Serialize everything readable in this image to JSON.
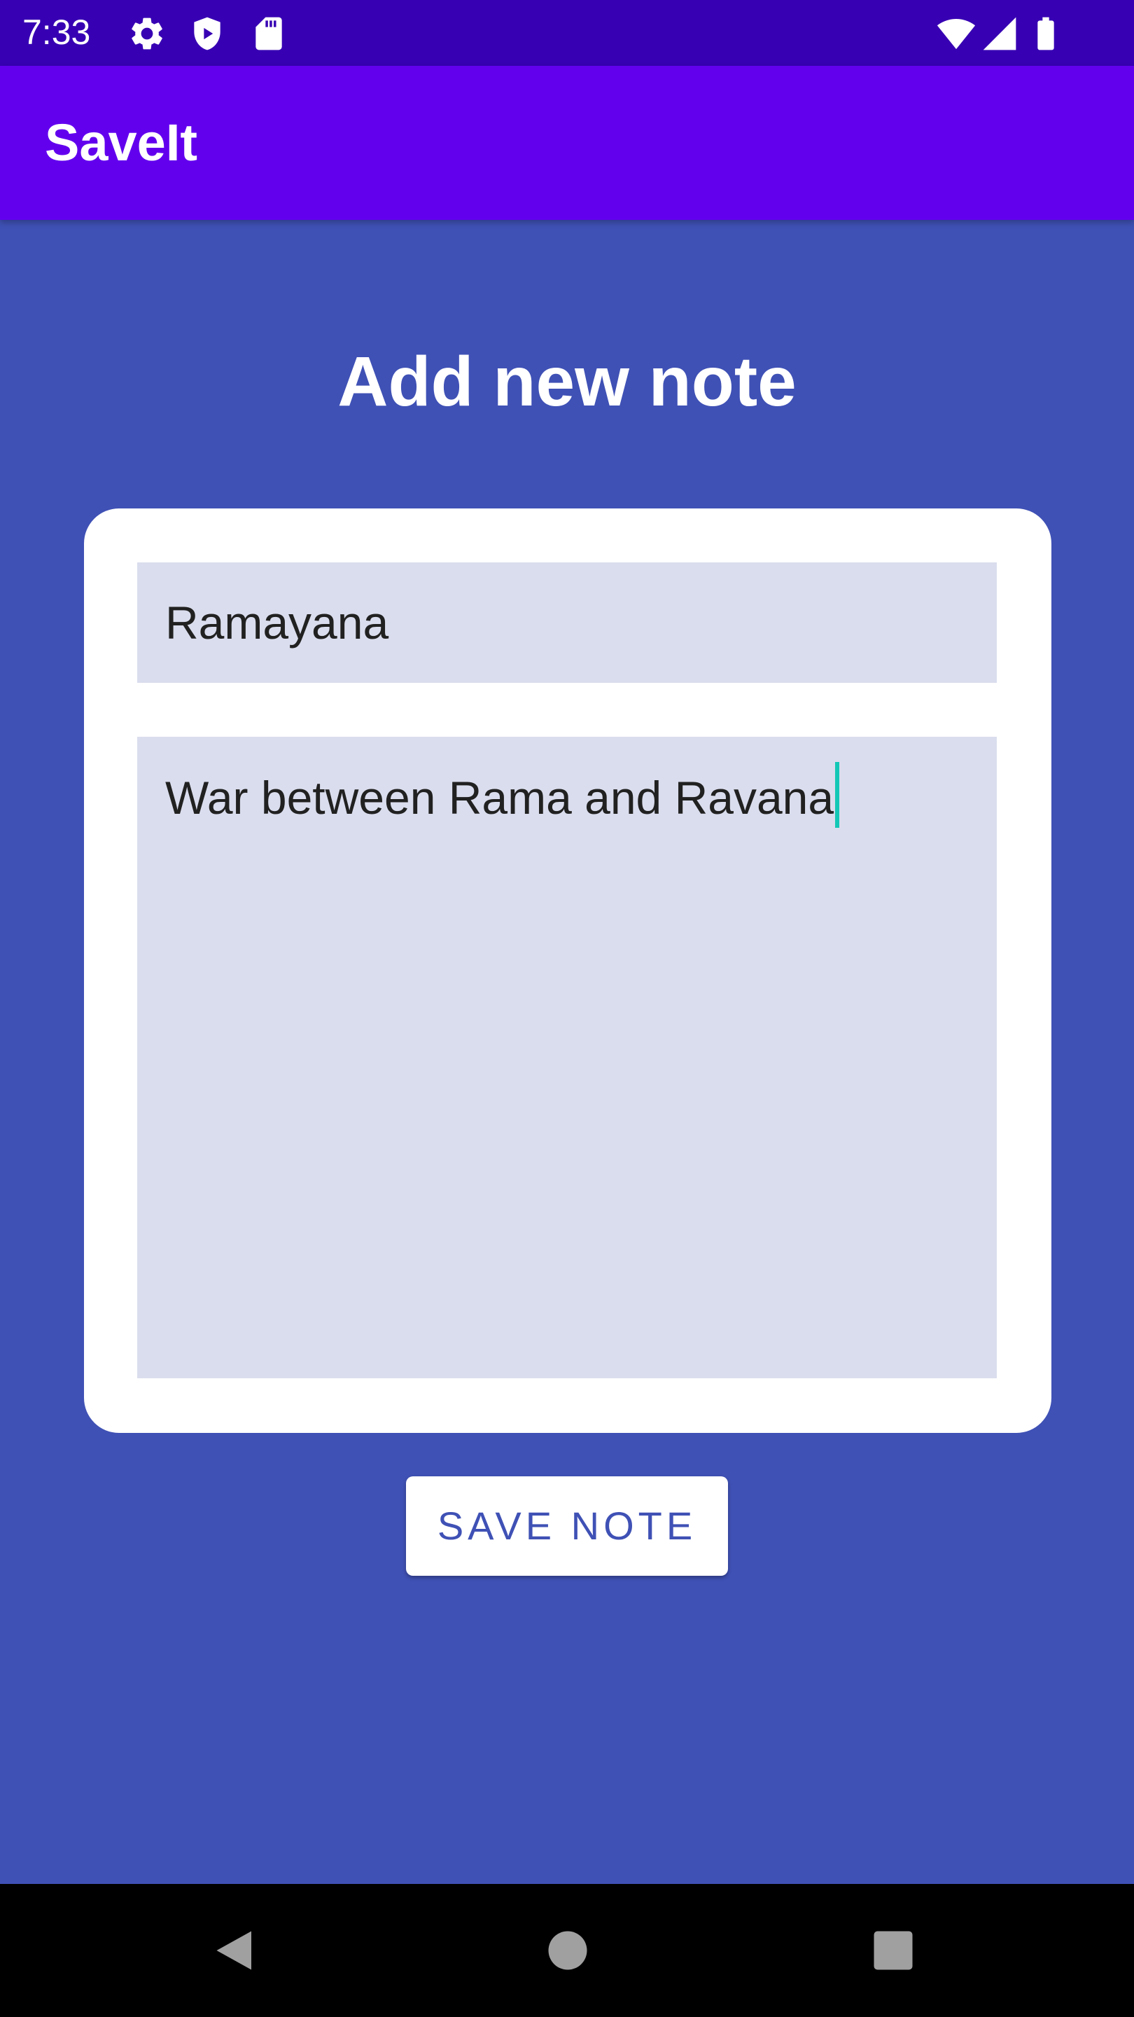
{
  "status_bar": {
    "time": "7:33",
    "left_icons": [
      "gear-icon",
      "shield-play-icon",
      "sd-card-icon"
    ],
    "right_icons": [
      "wifi-icon",
      "cell-signal-icon",
      "battery-icon"
    ]
  },
  "app_bar": {
    "title": "SaveIt"
  },
  "page": {
    "title": "Add new note"
  },
  "form": {
    "title_value": "Ramayana",
    "body_value": "War between Rama and Ravana"
  },
  "actions": {
    "save_label": "SAVE NOTE"
  },
  "nav_bar": {
    "icons": [
      "back-icon",
      "home-icon",
      "recents-icon"
    ]
  },
  "colors": {
    "background": "#3f51b5",
    "status_bar": "#3700b3",
    "app_bar": "#6200ee",
    "field_fill": "#dadded",
    "cursor": "#13c7b6"
  }
}
